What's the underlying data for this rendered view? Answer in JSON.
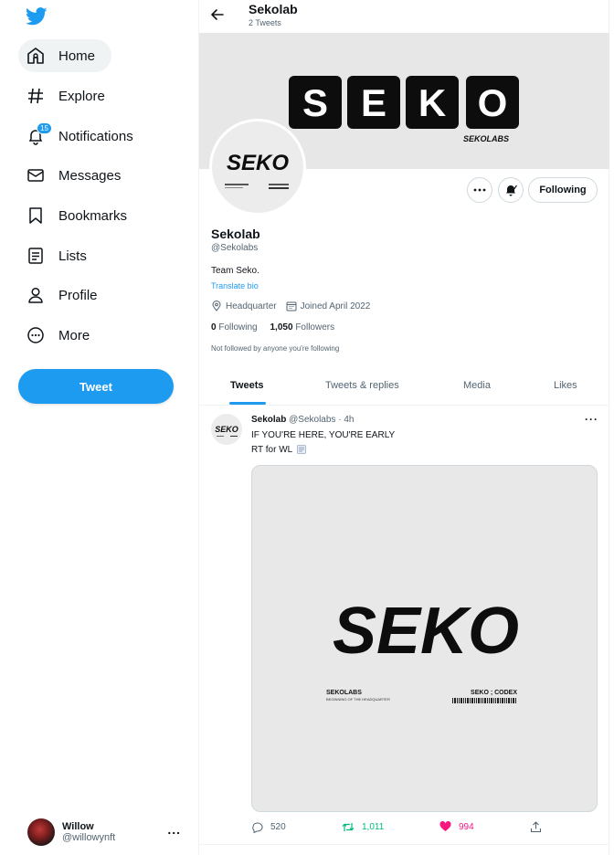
{
  "sidebar": {
    "items": [
      {
        "label": "Home",
        "icon": "home-icon"
      },
      {
        "label": "Explore",
        "icon": "hashtag-icon"
      },
      {
        "label": "Notifications",
        "icon": "bell-icon",
        "badge": "15"
      },
      {
        "label": "Messages",
        "icon": "mail-icon"
      },
      {
        "label": "Bookmarks",
        "icon": "bookmark-icon"
      },
      {
        "label": "Lists",
        "icon": "list-icon"
      },
      {
        "label": "Profile",
        "icon": "person-icon"
      },
      {
        "label": "More",
        "icon": "more-circle-icon"
      }
    ],
    "tweet_button": "Tweet",
    "account": {
      "name": "Willow",
      "handle": "@willowynft",
      "more": "..."
    }
  },
  "header": {
    "title": "Sekolab",
    "subtitle": "2 Tweets"
  },
  "banner": {
    "wordmark": [
      "S",
      "E",
      "K",
      "O"
    ],
    "tagline": "SEKOLABS"
  },
  "profile": {
    "name": "Sekolab",
    "handle": "@Sekolabs",
    "bio": "Team Seko.",
    "translate": "Translate bio",
    "location": "Headquarter",
    "joined": "Joined April 2022",
    "following_count": "0",
    "following_label": "Following",
    "followers_count": "1,050",
    "followers_label": "Followers",
    "note": "Not followed by anyone you're following",
    "following_button": "Following",
    "avatar_text": "SEKO"
  },
  "tabs": [
    "Tweets",
    "Tweets & replies",
    "Media",
    "Likes"
  ],
  "tweet": {
    "name": "Sekolab",
    "handle": "@Sekolabs",
    "time": "· 4h",
    "line1": "IF YOU'RE HERE, YOU'RE EARLY",
    "line2": "RT for WL",
    "image": {
      "wordmark": "SEKO",
      "left_title": "SEKOLABS",
      "left_sub": "BEGINNING OF THE HEADQUARTER",
      "right_title": "SEKO ; CODEX"
    },
    "replies": "520",
    "retweets": "1,011",
    "likes": "994"
  },
  "colors": {
    "accent": "#1d9bf0",
    "retweet": "#00ba7c",
    "like": "#f91880"
  }
}
